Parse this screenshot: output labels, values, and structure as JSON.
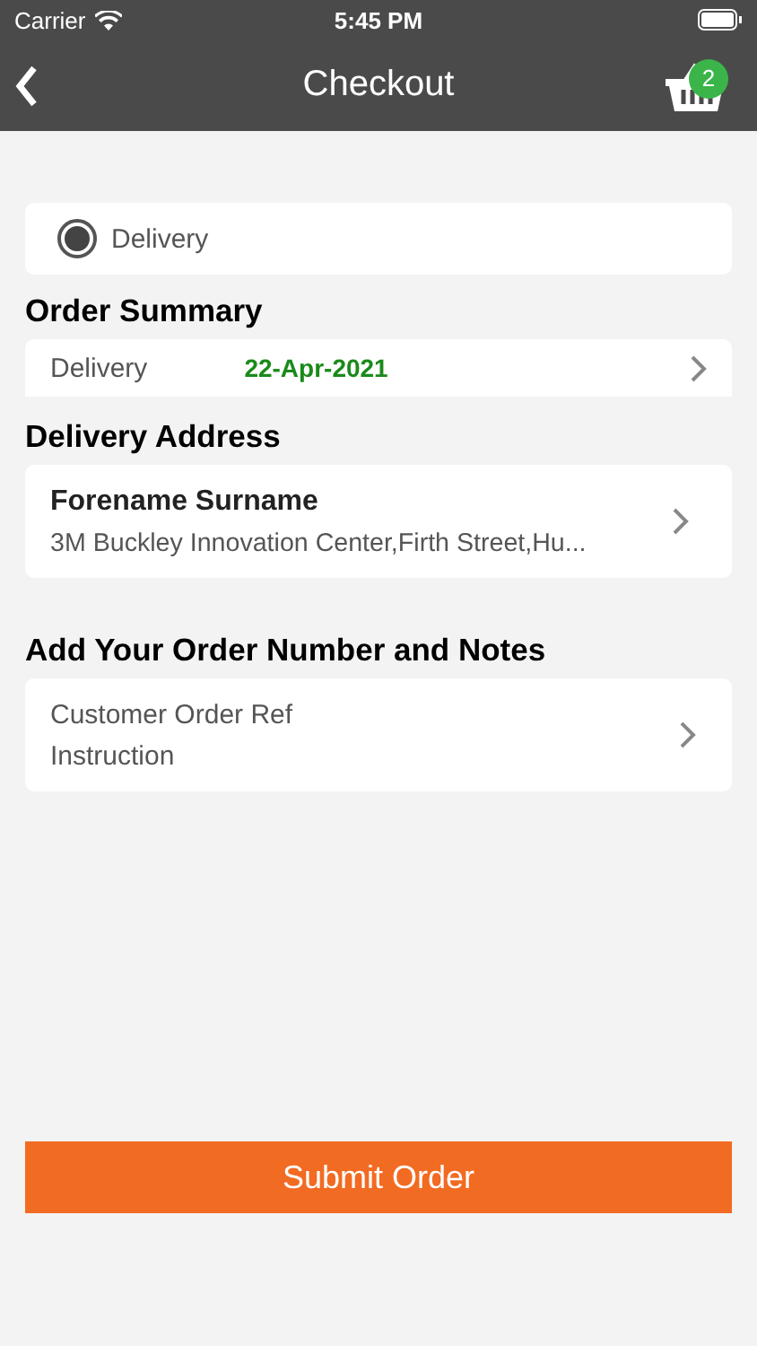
{
  "status_bar": {
    "carrier": "Carrier",
    "time": "5:45 PM"
  },
  "nav": {
    "title": "Checkout",
    "cart_count": "2"
  },
  "method_options": [
    {
      "label": "Delivery",
      "selected": true
    }
  ],
  "order_summary": {
    "heading": "Order Summary",
    "label": "Delivery",
    "date": "22-Apr-2021"
  },
  "delivery_address": {
    "heading": "Delivery Address",
    "name": "Forename Surname",
    "address": "3M Buckley Innovation Center,Firth Street,Hu..."
  },
  "notes": {
    "heading": "Add Your Order Number and Notes",
    "lines": [
      "Customer Order Ref",
      "Instruction"
    ]
  },
  "submit": {
    "label": "Submit Order"
  }
}
